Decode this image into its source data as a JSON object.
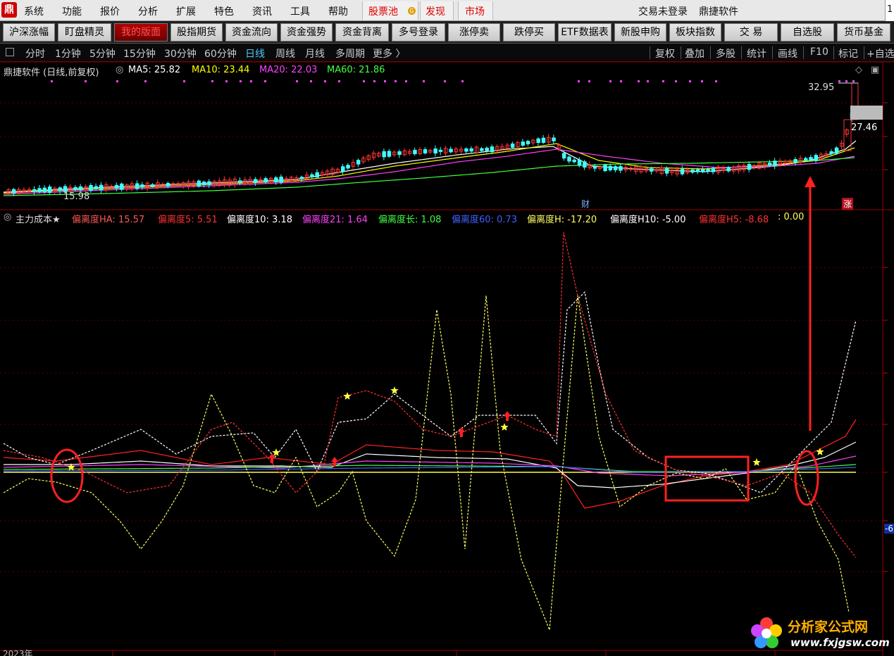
{
  "menu": {
    "logo": "鼎",
    "items": [
      "系统",
      "功能",
      "报价",
      "分析",
      "扩展",
      "特色",
      "资讯",
      "工具",
      "帮助"
    ],
    "stock_pool": "股票池",
    "coin": "G",
    "discover": "发现",
    "market": "市场",
    "login_status": "交易未登录",
    "app_name": "鼎捷软件",
    "right_clip": "1"
  },
  "toolbar": [
    "沪深涨幅",
    "盯盘精灵",
    "我的版面",
    "股指期货",
    "资金流向",
    "资金强势",
    "资金背离",
    "多号登录",
    "涨停卖",
    "跌停买",
    "ETF数据表",
    "新股申购",
    "板块指数",
    "交 易",
    "自选股",
    "货币基金"
  ],
  "toolbar_active": "我的版面",
  "periods": [
    "分时",
    "1分钟",
    "5分钟",
    "15分钟",
    "30分钟",
    "60分钟",
    "日线",
    "周线",
    "月线",
    "多周期",
    "更多 〉"
  ],
  "period_active": "日线",
  "right_tools": [
    "复权",
    "叠加",
    "多股",
    "统计",
    "画线",
    "F10",
    "标记",
    "+自选"
  ],
  "main_legend": {
    "title": "鼎捷软件 (日线,前复权)",
    "ma5": "MA5: 25.82",
    "ma10": "MA10: 23.44",
    "ma20": "MA20: 22.03",
    "ma60": "MA60: 21.86"
  },
  "price_labels": {
    "high": "32.95",
    "current": "27.46",
    "low": "15.98"
  },
  "event_marks": {
    "finance": "财",
    "rise": "涨"
  },
  "indicator_legend": {
    "name": "主力成本★",
    "items": [
      {
        "label": "偏离度HA: 15.57",
        "color": "#ff5555"
      },
      {
        "label": "偏离度5: 5.51",
        "color": "#ff3030"
      },
      {
        "label": "偏离度10: 3.18",
        "color": "#ffffff"
      },
      {
        "label": "偏离度21: 1.64",
        "color": "#ff40ff"
      },
      {
        "label": "偏离度长: 1.08",
        "color": "#40ff40"
      },
      {
        "label": "偏离度60: 0.73",
        "color": "#4060ff"
      },
      {
        "label": "偏离度H: -17.20",
        "color": "#ffff60"
      },
      {
        "label": "偏离度H10: -5.00",
        "color": "#ffffff"
      },
      {
        "label": "偏离度H5: -8.68",
        "color": "#ff3030"
      },
      {
        "label": ": 0.00",
        "color": "#ffff60"
      }
    ]
  },
  "axis_right_label": "-6",
  "bottom_year": "2023年",
  "watermark": {
    "title": "分析家公式网",
    "url": "www.fxjgsw.com"
  },
  "colors": {
    "ma5": "#ffffff",
    "ma10": "#ffff00",
    "ma20": "#ff40ff",
    "ma60": "#40ff40",
    "up": "#ff3333",
    "down": "#40ffff",
    "annotation": "#ff2020"
  }
}
